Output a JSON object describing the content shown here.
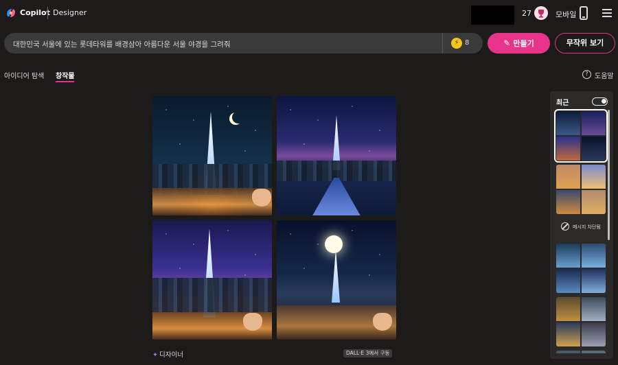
{
  "header": {
    "brand": "Copilot",
    "product": "Designer",
    "boost_count": "27",
    "mobile_label": "모바일"
  },
  "prompt": {
    "value": "대한민국 서울에 있는 롯데타워를 배경삼아 아름다운 서울 야경을 그려줘",
    "boost_remaining": "8",
    "create_label": "만들기",
    "surprise_label": "무작위 보기"
  },
  "tabs": [
    {
      "label": "아이디어 탐색",
      "active": false
    },
    {
      "label": "창작물",
      "active": true
    }
  ],
  "help_label": "도움말",
  "results": {
    "footer_brand": "디자이너",
    "model_badge": "DALL·E 3에서 구동"
  },
  "recent": {
    "title": "최근",
    "toggle_on": true,
    "blocked_label": "메시지 차단됨"
  },
  "colors": {
    "accent": "#e8338a",
    "background": "#1c1b1a",
    "input_bg": "#3a3a3a",
    "panel_bg": "#2b2a29"
  }
}
